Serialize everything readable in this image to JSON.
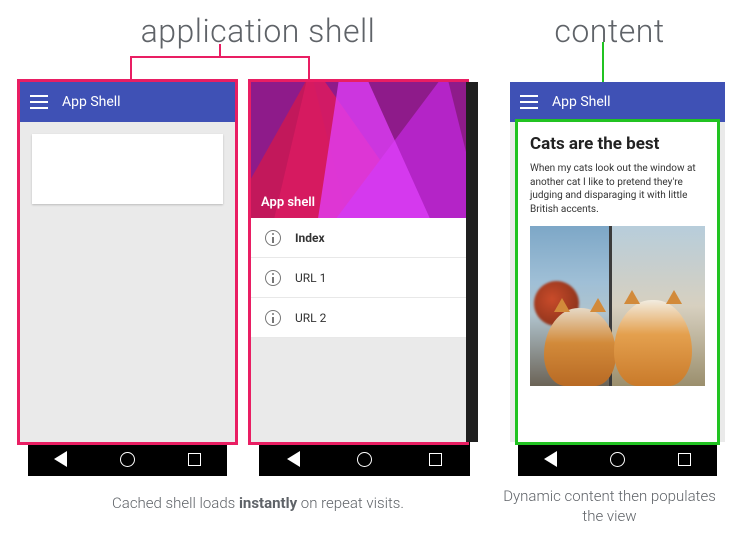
{
  "labels": {
    "shell": "application shell",
    "content": "content"
  },
  "appbar": {
    "title": "App Shell"
  },
  "hero": {
    "title": "App shell"
  },
  "list": {
    "items": [
      {
        "label": "Index",
        "active": true
      },
      {
        "label": "URL 1",
        "active": false
      },
      {
        "label": "URL 2",
        "active": false
      }
    ]
  },
  "article": {
    "title": "Cats are the best",
    "body": "When my cats look out the window at another cat I like to pretend they're judging and disparaging it with little British accents."
  },
  "captions": {
    "shell_pre": "Cached shell loads ",
    "shell_bold": "instantly",
    "shell_post": " on repeat visits.",
    "content": "Dynamic content then populates the view"
  },
  "colors": {
    "appbar": "#3f51b5",
    "shell_outline": "#e91e63",
    "content_outline": "#21c321"
  }
}
